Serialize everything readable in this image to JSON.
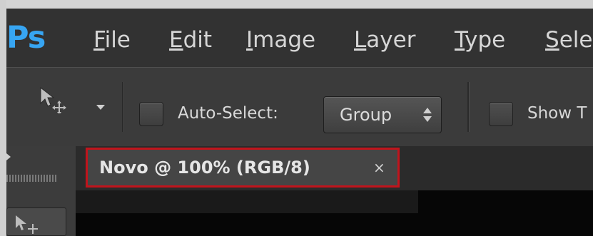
{
  "app": {
    "logo": "Ps"
  },
  "menu": {
    "items": [
      "File",
      "Edit",
      "Image",
      "Layer",
      "Type",
      "Sele"
    ]
  },
  "options": {
    "auto_select_label": "Auto-Select:",
    "auto_select_value": "Group",
    "show_transform_label": "Show T"
  },
  "document": {
    "tab_title": "Novo @ 100% (RGB/8)",
    "close_glyph": "×"
  },
  "colors": {
    "logo_blue": "#37a5f2",
    "highlight_red": "#c1141c"
  }
}
